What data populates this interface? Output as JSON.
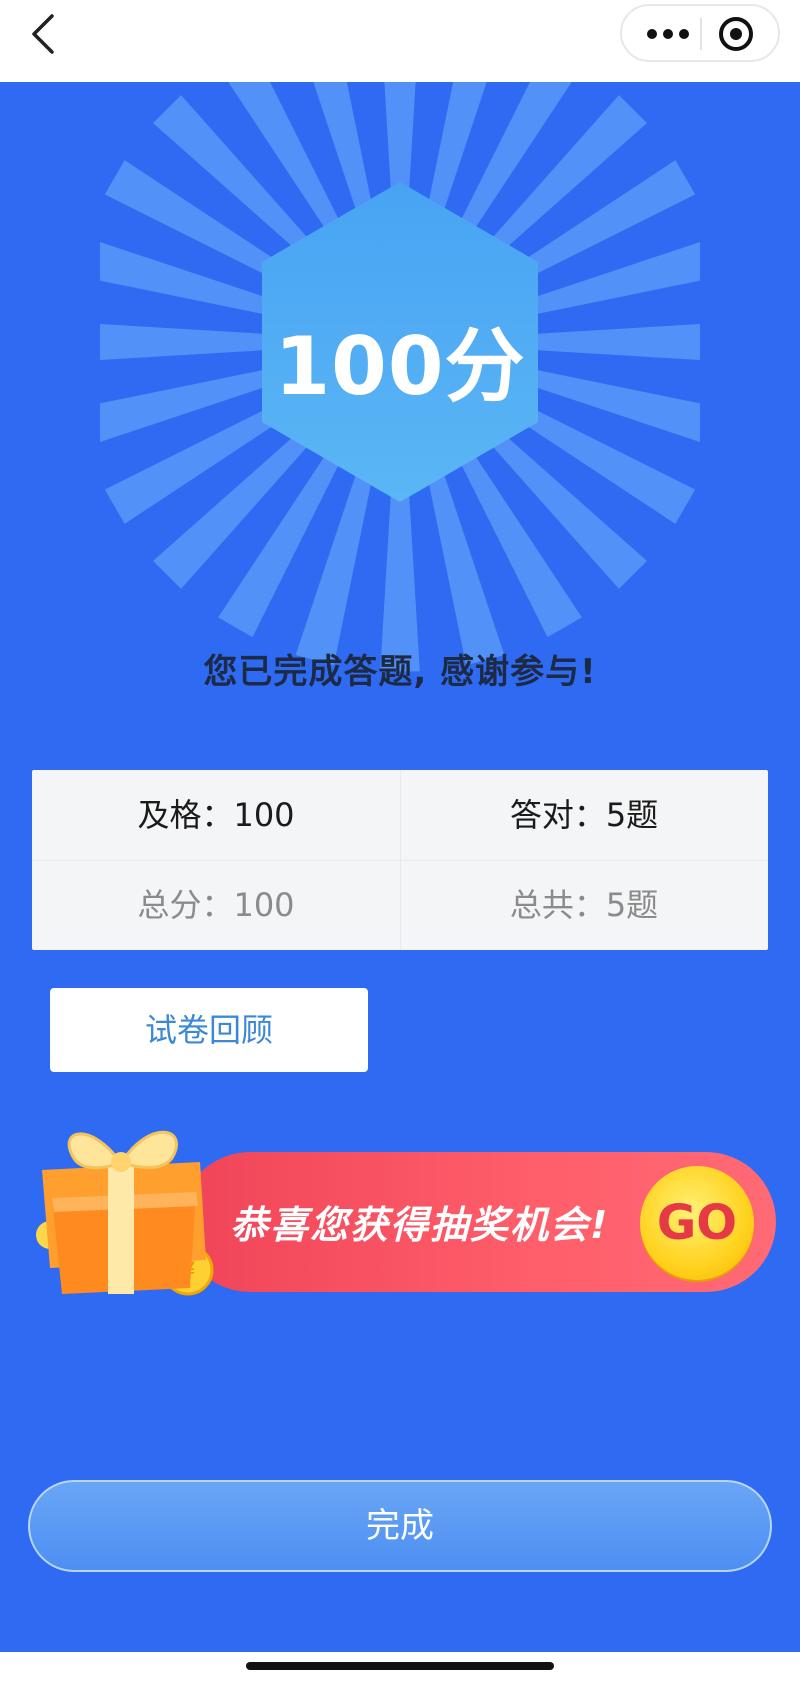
{
  "score": {
    "value": "100分"
  },
  "message": "您已完成答题, 感谢参与!",
  "stats": {
    "pass": "及格：100",
    "correct": "答对：5题",
    "total_score": "总分：100",
    "total_questions": "总共：5题"
  },
  "review_button": "试卷回顾",
  "lottery": {
    "text": "恭喜您获得抽奖机会!",
    "go": "GO",
    "coin_symbol": "¥"
  },
  "done_button": "完成",
  "icons": [
    "back-arrow-icon",
    "more-dots-icon",
    "close-target-icon",
    "gift-box-icon",
    "coin-icon"
  ],
  "colors": {
    "background": "#2f6bf2",
    "badge": "#4aa7f2",
    "lottery_red": "#f04458",
    "go_yellow": "#ffd21e"
  }
}
